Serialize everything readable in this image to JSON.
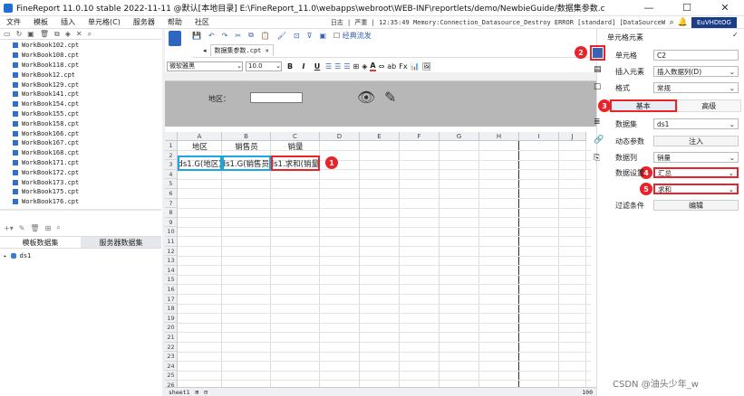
{
  "window": {
    "title": "FineReport 11.0.10 stable 2022-11-11 @默认[本地目录]    E:\\FineReport_11.0\\webapps\\webroot\\WEB-INF\\reportlets/demo/NewbieGuide/数据集参数.cpt",
    "minimize": "—",
    "maximize": "☐",
    "close": "✕"
  },
  "menu": {
    "items": [
      "文件",
      "模板",
      "插入",
      "单元格(C)",
      "服务器",
      "帮助",
      "社区"
    ],
    "log": "日志 | 严重 | 12:35:49 Memory:Connection_Datasource_Destroy ERROR [standard] [DataSourceWrapper]Data",
    "user": "EuVHDtOG"
  },
  "left": {
    "files": [
      "WorkBook102.cpt",
      "WorkBook108.cpt",
      "WorkBook118.cpt",
      "WorkBook12.cpt",
      "WorkBook129.cpt",
      "WorkBook141.cpt",
      "WorkBook154.cpt",
      "WorkBook155.cpt",
      "WorkBook158.cpt",
      "WorkBook166.cpt",
      "WorkBook167.cpt",
      "WorkBook168.cpt",
      "WorkBook171.cpt",
      "WorkBook172.cpt",
      "WorkBook173.cpt",
      "WorkBook175.cpt",
      "WorkBook176.cpt"
    ],
    "tab_template": "模板数据集",
    "tab_server": "服务器数据集",
    "dataset": "ds1"
  },
  "editor": {
    "doc_tab": "数据集参数.cpt",
    "classic_lbl": "经典流发",
    "font_name": "微软雅黑",
    "font_size": "10.0",
    "bold": "B",
    "italic": "I",
    "underline": "U",
    "param_label": "地区：",
    "columns": [
      "A",
      "B",
      "C",
      "D",
      "E",
      "F",
      "G",
      "H",
      "I",
      "J"
    ],
    "rows": [
      "1",
      "2",
      "3",
      "4",
      "5",
      "6",
      "7",
      "8",
      "9",
      "10",
      "11",
      "12",
      "13",
      "14",
      "15",
      "16",
      "17",
      "18",
      "19",
      "20",
      "21",
      "22",
      "23",
      "24",
      "25",
      "26"
    ],
    "a1": "地区",
    "b1": "销售员",
    "c1": "销量",
    "a2": "ds1.G(地区)",
    "b2": "ds1.G(销售员)",
    "c2": "ds1.求和(销量)",
    "sheet": "sheet1",
    "zoom": "100"
  },
  "callouts": {
    "c1": "1",
    "c2": "2",
    "c3": "3",
    "c4": "4",
    "c5": "5"
  },
  "right": {
    "title": "单元格元素",
    "cell_lbl": "单元格",
    "cell_val": "C2",
    "insert_lbl": "插入元素",
    "insert_val": "插入数据列(D)",
    "format_lbl": "格式",
    "format_val": "常规",
    "tab_basic": "基本",
    "tab_adv": "高级",
    "ds_lbl": "数据集",
    "ds_val": "ds1",
    "dyn_lbl": "动态参数",
    "dyn_btn": "注入",
    "col_lbl": "数据列",
    "col_val": "销量",
    "set_lbl": "数据设置",
    "set_val": "汇总",
    "agg_val": "求和",
    "filter_lbl": "过滤条件",
    "filter_btn": "编辑"
  },
  "footer": {
    "csdn": "CSDN @油头少年_w"
  },
  "colors": {
    "accent": "#2e66c0",
    "badge": "#e8232a",
    "cellBorder": "#1ba6df"
  }
}
